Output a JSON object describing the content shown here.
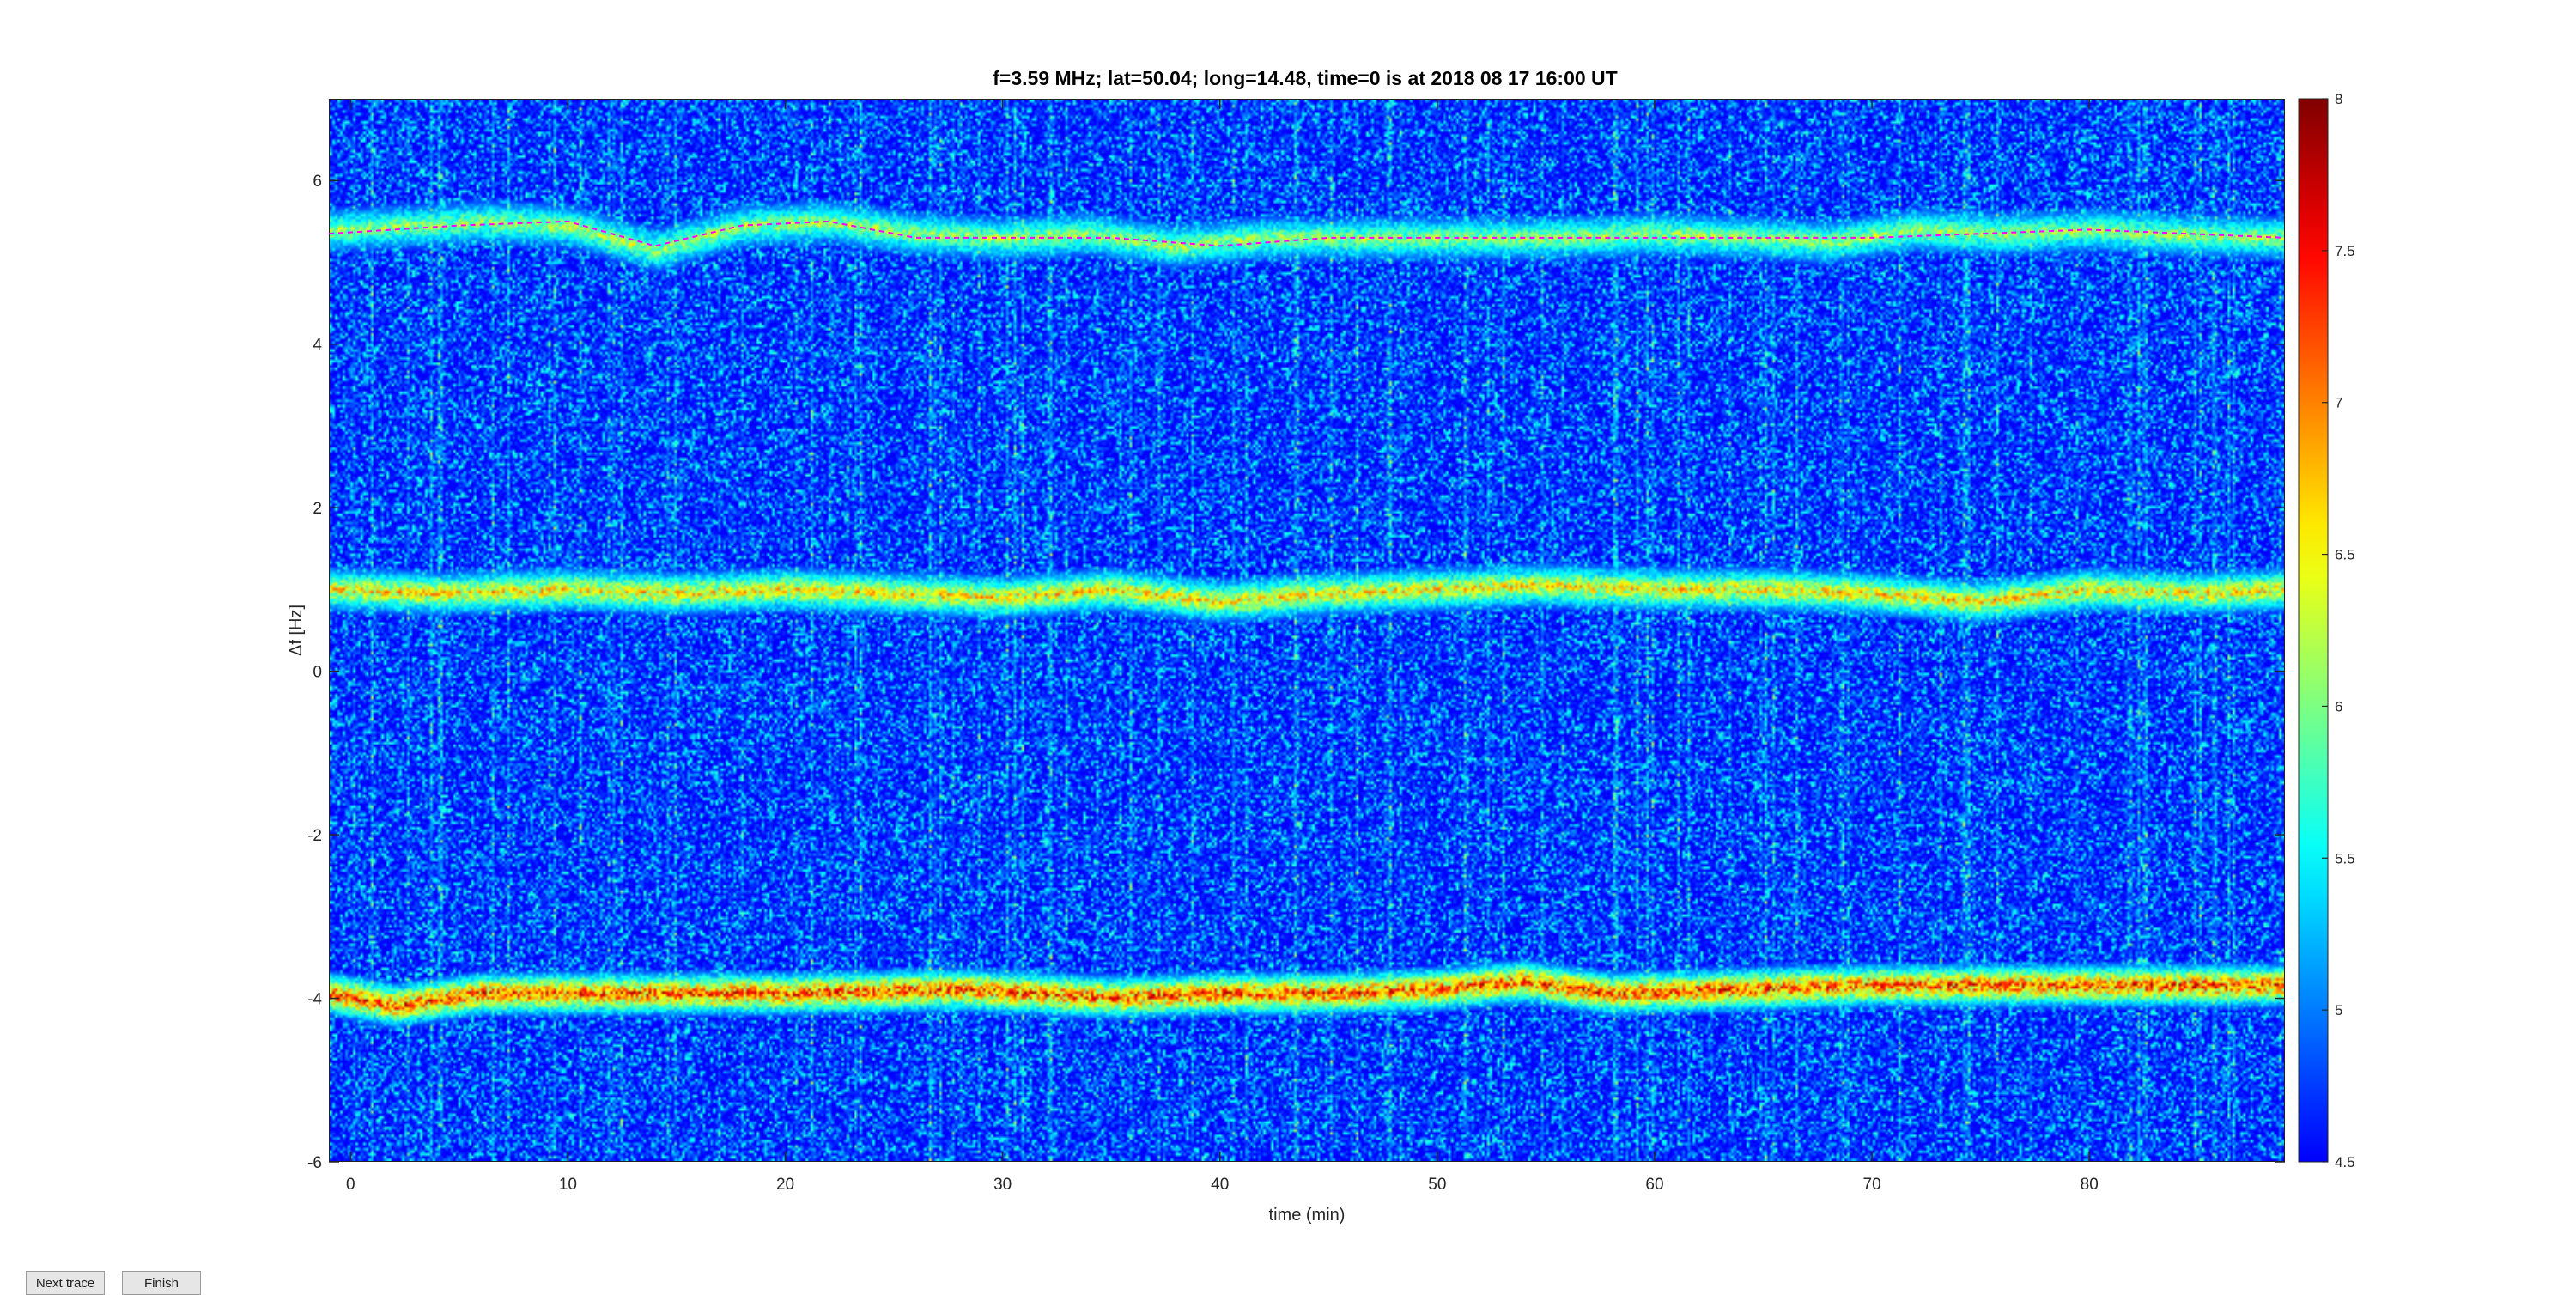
{
  "chart_data": {
    "type": "heatmap",
    "title": "f=3.59 MHz;  lat=50.04; long=14.48, time=0 is at 2018 08 17 16:00 UT",
    "xlabel": "time (min)",
    "ylabel": "Δf [Hz]",
    "xlim": [
      -1,
      89
    ],
    "ylim": [
      -6,
      7
    ],
    "xticks": [
      0,
      10,
      20,
      30,
      40,
      50,
      60,
      70,
      80
    ],
    "yticks": [
      -6,
      -4,
      -2,
      0,
      2,
      4,
      6
    ],
    "colorbar": {
      "range": [
        4.5,
        8
      ],
      "ticks": [
        4.5,
        5,
        5.5,
        6,
        6.5,
        7,
        7.5,
        8
      ],
      "colormap": "jet"
    },
    "traces": [
      {
        "x": [
          -1,
          3,
          6,
          10,
          14,
          18,
          22,
          26,
          30,
          34,
          38,
          42,
          46,
          50,
          55,
          60,
          65,
          68,
          72,
          76,
          80,
          84,
          89
        ],
        "y": [
          5.4,
          5.45,
          5.5,
          5.45,
          5.15,
          5.45,
          5.5,
          5.35,
          5.3,
          5.35,
          5.2,
          5.3,
          5.3,
          5.3,
          5.3,
          5.35,
          5.3,
          5.25,
          5.4,
          5.35,
          5.4,
          5.35,
          5.3
        ],
        "intensity": 6.4
      },
      {
        "x": [
          -1,
          4,
          10,
          15,
          20,
          25,
          30,
          35,
          40,
          45,
          50,
          55,
          60,
          65,
          70,
          75,
          80,
          85,
          89
        ],
        "y": [
          1.0,
          0.95,
          1.0,
          0.95,
          1.0,
          0.95,
          0.9,
          1.0,
          0.85,
          0.95,
          1.0,
          1.05,
          1.0,
          1.0,
          0.95,
          0.85,
          1.0,
          0.95,
          1.0
        ],
        "intensity": 6.9
      },
      {
        "x": [
          -1,
          2,
          6,
          12,
          20,
          28,
          35,
          40,
          45,
          50,
          54,
          58,
          64,
          70,
          76,
          82,
          89
        ],
        "y": [
          -3.95,
          -4.1,
          -3.95,
          -3.95,
          -3.95,
          -3.9,
          -4.0,
          -3.95,
          -3.95,
          -3.9,
          -3.8,
          -3.95,
          -3.9,
          -3.85,
          -3.85,
          -3.85,
          -3.85
        ],
        "intensity": 7.6
      }
    ],
    "dashed_trace": {
      "x": [
        -1,
        5,
        10,
        14,
        18,
        22,
        26,
        30,
        35,
        40,
        45,
        50,
        60,
        70,
        80,
        89
      ],
      "y": [
        5.35,
        5.45,
        5.5,
        5.2,
        5.45,
        5.5,
        5.3,
        5.3,
        5.3,
        5.2,
        5.3,
        5.3,
        5.3,
        5.3,
        5.4,
        5.3
      ],
      "color": "#ff00ff"
    }
  },
  "buttons": {
    "next_label": "Next trace",
    "finish_label": "Finish"
  }
}
